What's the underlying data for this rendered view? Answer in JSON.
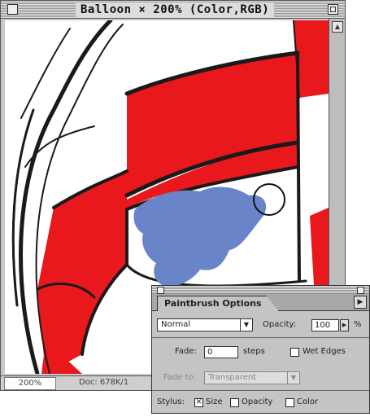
{
  "document_window": {
    "title": "Balloon × 200% (Color,RGB)",
    "status": {
      "zoom": "200%",
      "doc_size": "Doc: 678K/1"
    }
  },
  "canvas": {
    "colors": {
      "stripe_red": "#e8181c",
      "brush_stroke_blue": "#6a84c9",
      "outline_dark": "#1a1a1a",
      "paper_white": "#ffffff"
    },
    "cursor_icon": "brush-circle-cursor"
  },
  "palette": {
    "tab_label": "Paintbrush Options",
    "mode": "Normal",
    "opacity_label": "Opacity:",
    "opacity_value": "100",
    "opacity_unit": "%",
    "fade_label": "Fade:",
    "fade_value": "0",
    "fade_unit": "steps",
    "wet_edges_label": "Wet Edges",
    "wet_edges_checked": false,
    "fade_to_label": "Fade to:",
    "fade_to_value": "Transparent",
    "stylus_label": "Stylus:",
    "stylus_options": [
      {
        "label": "Size",
        "checked": true
      },
      {
        "label": "Opacity",
        "checked": false
      },
      {
        "label": "Color",
        "checked": false
      }
    ]
  }
}
